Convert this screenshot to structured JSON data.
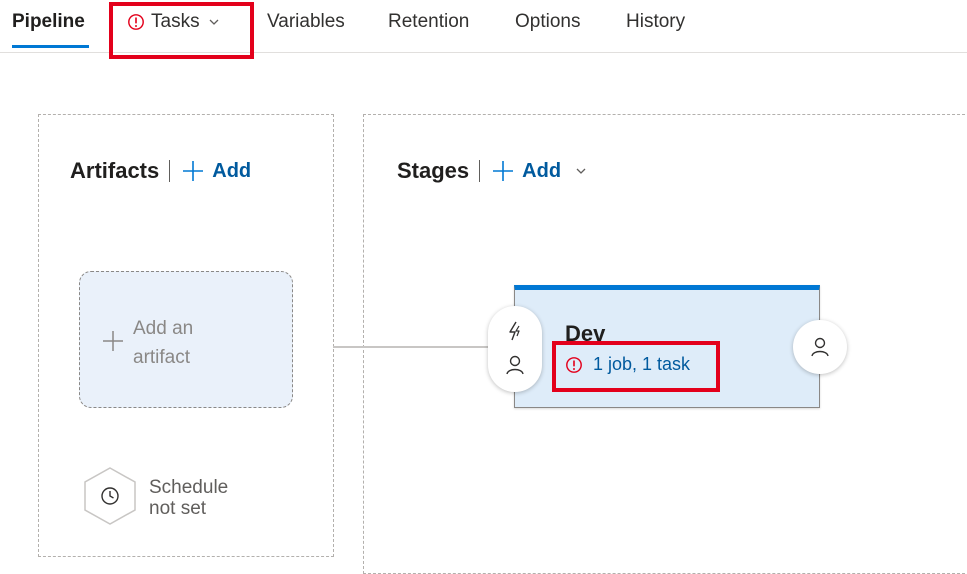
{
  "tabs": [
    {
      "label": "Pipeline",
      "active": true
    },
    {
      "label": "Tasks",
      "active": false,
      "status": "error"
    },
    {
      "label": "Variables",
      "active": false
    },
    {
      "label": "Retention",
      "active": false
    },
    {
      "label": "Options",
      "active": false
    },
    {
      "label": "History",
      "active": false
    }
  ],
  "artifacts": {
    "title": "Artifacts",
    "add_label": "Add",
    "placeholder_line1": "Add an",
    "placeholder_line2": "artifact",
    "schedule_line1": "Schedule",
    "schedule_line2": "not set"
  },
  "stages": {
    "title": "Stages",
    "add_label": "Add",
    "items": [
      {
        "name": "Dev",
        "status_text": "1 job, 1 task",
        "status": "error"
      }
    ]
  },
  "colors": {
    "accent": "#0078d4",
    "link": "#005a9e",
    "error": "#e3001b",
    "stage_bg": "#deecf9",
    "artifact_bg": "#eaf1fa"
  },
  "icons": {
    "tasks_status": "error-circle-icon",
    "tasks_dropdown": "chevron-down-icon",
    "add": "plus-icon",
    "schedule": "clock-icon",
    "pre_deployment_trigger": "lightning-icon",
    "pre_deployment_approvals": "person-icon",
    "post_deployment_approvals": "person-icon"
  }
}
